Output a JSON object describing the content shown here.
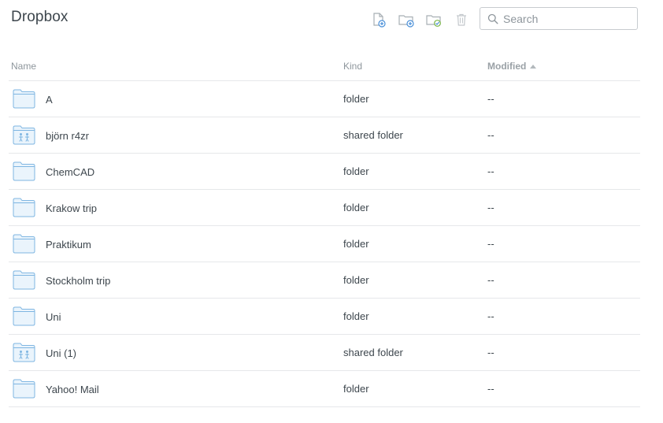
{
  "header": {
    "title": "Dropbox"
  },
  "toolbar": {
    "buttons": [
      {
        "icon": "new-file-icon"
      },
      {
        "icon": "new-folder-icon"
      },
      {
        "icon": "new-shared-folder-icon"
      },
      {
        "icon": "trash-icon"
      }
    ]
  },
  "search": {
    "placeholder": "Search",
    "value": ""
  },
  "table": {
    "columns": {
      "name": "Name",
      "kind": "Kind",
      "modified": "Modified"
    },
    "sort": {
      "column": "modified",
      "direction": "ascending"
    },
    "rows": [
      {
        "name": "A",
        "kind": "folder",
        "modified": "--",
        "icon": "folder-icon"
      },
      {
        "name": "björn r4zr",
        "kind": "shared folder",
        "modified": "--",
        "icon": "shared-folder-icon"
      },
      {
        "name": "ChemCAD",
        "kind": "folder",
        "modified": "--",
        "icon": "folder-icon"
      },
      {
        "name": "Krakow trip",
        "kind": "folder",
        "modified": "--",
        "icon": "folder-icon"
      },
      {
        "name": "Praktikum",
        "kind": "folder",
        "modified": "--",
        "icon": "folder-icon"
      },
      {
        "name": "Stockholm trip",
        "kind": "folder",
        "modified": "--",
        "icon": "folder-icon"
      },
      {
        "name": "Uni",
        "kind": "folder",
        "modified": "--",
        "icon": "folder-icon"
      },
      {
        "name": "Uni (1)",
        "kind": "shared folder",
        "modified": "--",
        "icon": "shared-folder-icon"
      },
      {
        "name": "Yahoo! Mail",
        "kind": "folder",
        "modified": "--",
        "icon": "folder-icon"
      }
    ]
  },
  "colors": {
    "folder_fill": "#eaf4fc",
    "folder_stroke": "#7fb6e2",
    "icon_gray": "#a8afb4",
    "accent_blue": "#4a90d9",
    "divider": "#e6e8ea"
  }
}
